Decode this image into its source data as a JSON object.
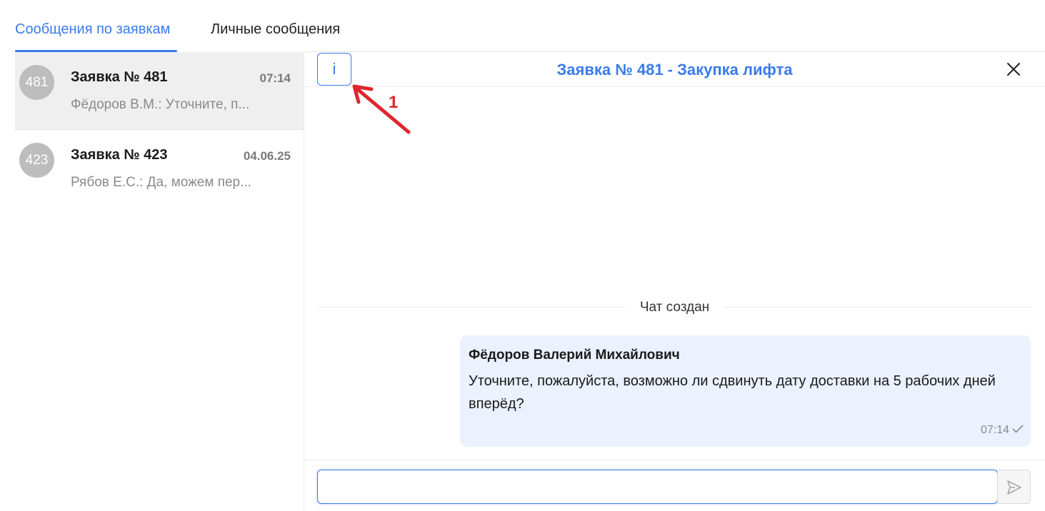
{
  "tabs": [
    {
      "label": "Сообщения по заявкам",
      "active": true
    },
    {
      "label": "Личные сообщения",
      "active": false
    }
  ],
  "conversations": [
    {
      "avatar": "481",
      "title": "Заявка № 481",
      "time": "07:14",
      "preview": "Фёдоров В.М.: Уточните, п...",
      "selected": true
    },
    {
      "avatar": "423",
      "title": "Заявка № 423",
      "time": "04.06.25",
      "preview": "Рябов Е.С.: Да, можем пер...",
      "selected": false
    }
  ],
  "chat": {
    "info_label": "i",
    "title": "Заявка № 481 - Закупка лифта",
    "annotation_number": "1",
    "system_message": "Чат создан",
    "messages": [
      {
        "author": "Фёдоров Валерий Михайлович",
        "text": "Уточните, пожалуйста, возможно ли сдвинуть дату доставки на 5 рабочих дней вперёд?",
        "time": "07:14",
        "read_icon": "check-icon"
      }
    ],
    "input": {
      "value": "",
      "placeholder": ""
    },
    "send_icon": "send-icon",
    "close_icon": "close-icon"
  },
  "colors": {
    "accent": "#3a7bea",
    "bubble_bg": "#ebf1fd",
    "annotation": "#e0252e",
    "avatar_bg": "#bdbdbd"
  }
}
